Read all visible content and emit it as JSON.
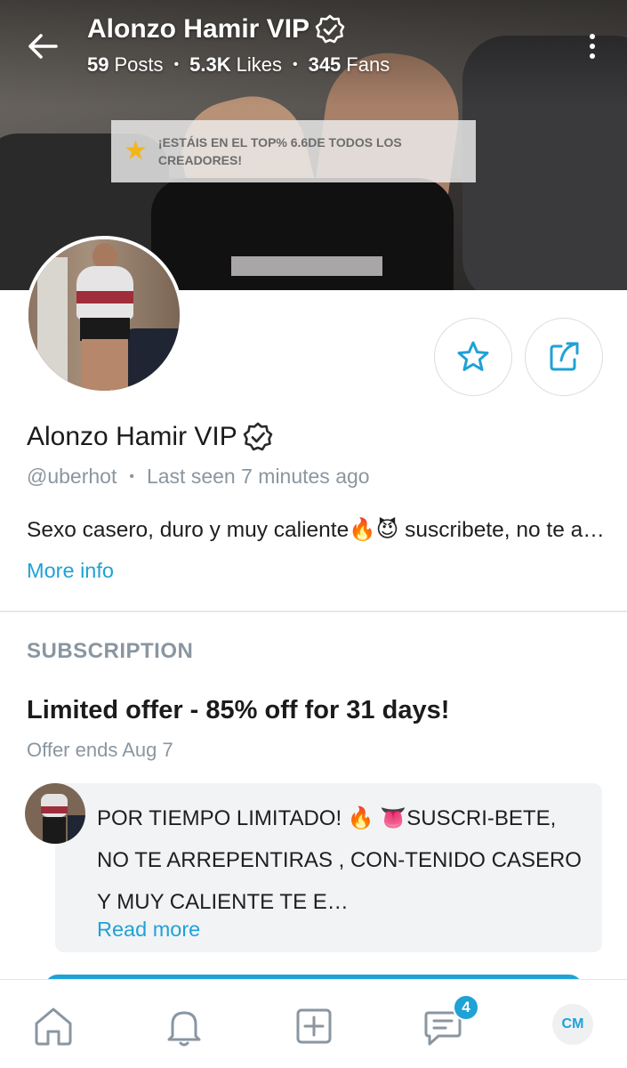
{
  "header": {
    "title": "Alonzo Hamir VIP",
    "stats": [
      {
        "value": "59",
        "label": "Posts"
      },
      {
        "value": "5.3K",
        "label": "Likes"
      },
      {
        "value": "345",
        "label": "Fans"
      }
    ],
    "separator": "•"
  },
  "cover": {
    "toast_text": "¡ESTÁIS EN EL TOP% 6.6DE TODOS LOS CREADORES!",
    "toast_icon": "star-icon"
  },
  "profile": {
    "name": "Alonzo Hamir VIP",
    "handle": "@uberhot",
    "separator": "•",
    "last_seen": "Last seen 7 minutes ago",
    "bio": "Sexo casero, duro y muy caliente🔥😈 suscribete, no te arrepentiras",
    "more_info": "More info"
  },
  "subscription": {
    "heading": "SUBSCRIPTION",
    "offer_title": "Limited offer - 85% off for 31 days!",
    "offer_ends": "Offer ends Aug 7",
    "message": "POR TIEMPO LIMITADO! 🔥 👅SUSCRI-BETE, NO TE ARREPENTIRAS , CON-TENIDO CASERO Y MUY CALIENTE TE E…",
    "read_more": "Read more"
  },
  "nav": {
    "items": [
      "home-icon",
      "bell-icon",
      "add-post-icon",
      "messages-icon",
      "profile-avatar"
    ],
    "messages_badge": "4",
    "me_initials": "CM"
  },
  "colors": {
    "accent": "#1fa2d6",
    "muted": "#8a96a0",
    "star": "#f2b51c"
  }
}
